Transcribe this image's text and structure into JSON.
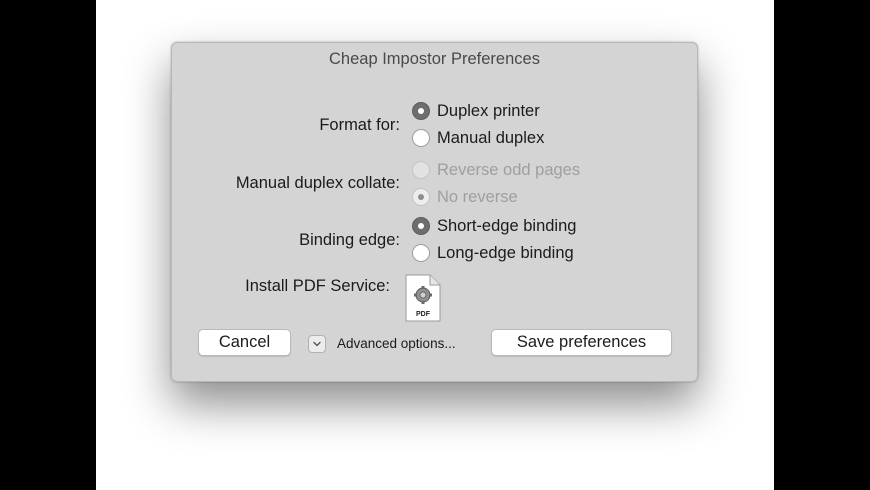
{
  "dialog": {
    "title": "Cheap Impostor Preferences",
    "format_for": {
      "label": "Format for:",
      "options": [
        "Duplex printer",
        "Manual duplex"
      ],
      "selected": "Duplex printer"
    },
    "manual_duplex_collate": {
      "label": "Manual duplex collate:",
      "options": [
        "Reverse odd pages",
        "No reverse"
      ],
      "selected": "No reverse",
      "disabled": true
    },
    "binding_edge": {
      "label": "Binding edge:",
      "options": [
        "Short-edge binding",
        "Long-edge binding"
      ],
      "selected": "Short-edge binding"
    },
    "install_pdf_service": {
      "label": "Install PDF Service:",
      "icon": "pdf-service-icon",
      "icon_text": "PDF"
    },
    "buttons": {
      "cancel": "Cancel",
      "advanced": "Advanced options...",
      "save": "Save preferences"
    }
  },
  "colors": {
    "dialog_bg": "#d4d4d4",
    "backdrop": "#ffffff",
    "outer_bg": "#000000",
    "radio_selected": "#6e6e6e",
    "disabled_text": "#9f9f9f"
  }
}
